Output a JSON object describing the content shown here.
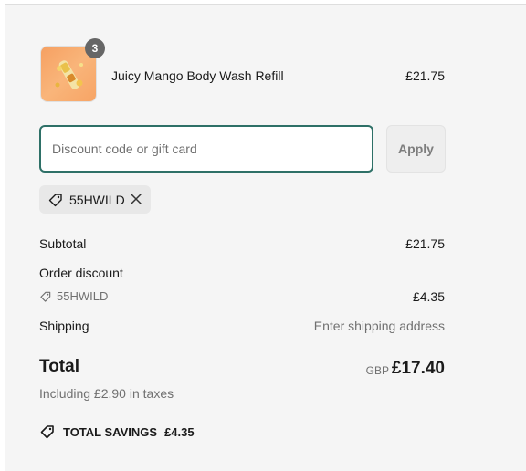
{
  "line_item": {
    "name": "Juicy Mango Body Wash Refill",
    "price": "£21.75",
    "quantity": "3",
    "thumbnail_icon": "product-thumbnail"
  },
  "discount": {
    "placeholder": "Discount code or gift card",
    "apply_label": "Apply",
    "applied_code": "55HWILD",
    "tag_icon": "tag-icon",
    "remove_icon": "close-icon"
  },
  "summary": {
    "subtotal_label": "Subtotal",
    "subtotal_value": "£21.75",
    "order_discount_label": "Order discount",
    "order_discount_code": "55HWILD",
    "order_discount_value": "– £4.35",
    "shipping_label": "Shipping",
    "shipping_value": "Enter shipping address",
    "total_label": "Total",
    "total_currency": "GBP",
    "total_value": "£17.40",
    "tax_note": "Including £2.90 in taxes",
    "savings_label": "TOTAL SAVINGS",
    "savings_value": "£4.35"
  },
  "colors": {
    "input_border": "#2e7067",
    "panel_background": "#f5f5f5",
    "muted_text": "#707070"
  }
}
